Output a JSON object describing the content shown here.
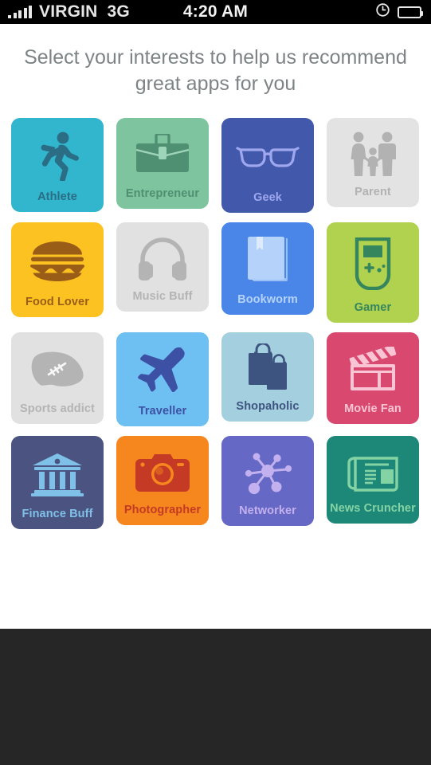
{
  "status_bar": {
    "signal_icon": "signal-bars-icon",
    "carrier": "VIRGIN",
    "network": "3G",
    "time": "4:20 AM",
    "alarm_icon": "alarm-clock-icon",
    "battery_icon": "battery-full-icon"
  },
  "header": {
    "headline": "Select your interests to help us recommend great apps for you"
  },
  "interests": [
    {
      "id": "athlete",
      "label": "Athlete",
      "icon": "runner-icon",
      "bg": "#31b6cd",
      "fg": "#2a6d85",
      "selected": true
    },
    {
      "id": "entrepreneur",
      "label": "Entrepreneur",
      "icon": "briefcase-icon",
      "bg": "#7ec49f",
      "fg": "#4f8f72",
      "selected": true
    },
    {
      "id": "geek",
      "label": "Geek",
      "icon": "glasses-icon",
      "bg": "#4259ab",
      "fg": "#9fa7ef",
      "selected": true
    },
    {
      "id": "parent",
      "label": "Parent",
      "icon": "family-icon",
      "bg": "#e3e3e3",
      "fg": "#b2b2b2",
      "selected": false
    },
    {
      "id": "food-lover",
      "label": "Food Lover",
      "icon": "burger-icon",
      "bg": "#fcc222",
      "fg": "#9a5d17",
      "selected": true
    },
    {
      "id": "music-buff",
      "label": "Music Buff",
      "icon": "headphones-icon",
      "bg": "#e1e1e1",
      "fg": "#b4b4b4",
      "selected": false
    },
    {
      "id": "bookworm",
      "label": "Bookworm",
      "icon": "book-icon",
      "bg": "#4a86e8",
      "fg": "#b5d3fa",
      "selected": true
    },
    {
      "id": "gamer",
      "label": "Gamer",
      "icon": "handheld-console-icon",
      "bg": "#b0d24f",
      "fg": "#35855d",
      "selected": true
    },
    {
      "id": "sports-addict",
      "label": "Sports addict",
      "icon": "football-icon",
      "bg": "#e1e1e1",
      "fg": "#b4b4b4",
      "selected": false
    },
    {
      "id": "traveller",
      "label": "Traveller",
      "icon": "airplane-icon",
      "bg": "#6fc0f2",
      "fg": "#3c51a4",
      "selected": true
    },
    {
      "id": "shopaholic",
      "label": "Shopaholic",
      "icon": "shopping-bags-icon",
      "bg": "#a4cfdf",
      "fg": "#3d5480",
      "selected": true
    },
    {
      "id": "movie-fan",
      "label": "Movie Fan",
      "icon": "clapperboard-icon",
      "bg": "#d9496f",
      "fg": "#f9c4d3",
      "selected": true
    },
    {
      "id": "finance-buff",
      "label": "Finance Buff",
      "icon": "bank-icon",
      "bg": "#4b5380",
      "fg": "#7fc0e8",
      "selected": true
    },
    {
      "id": "photographer",
      "label": "Photographer",
      "icon": "camera-icon",
      "bg": "#f6871f",
      "fg": "#c43a24",
      "selected": true
    },
    {
      "id": "networker",
      "label": "Networker",
      "icon": "network-nodes-icon",
      "bg": "#6568c4",
      "fg": "#c3b0ef",
      "selected": true
    },
    {
      "id": "news-cruncher",
      "label": "News Cruncher",
      "icon": "newspaper-icon",
      "bg": "#1d8778",
      "fg": "#84d3a4",
      "selected": true
    }
  ],
  "tile_heights": [
    118,
    114,
    119,
    112,
    119,
    112,
    116,
    126,
    115,
    118,
    112,
    115,
    117,
    112,
    113,
    110
  ]
}
